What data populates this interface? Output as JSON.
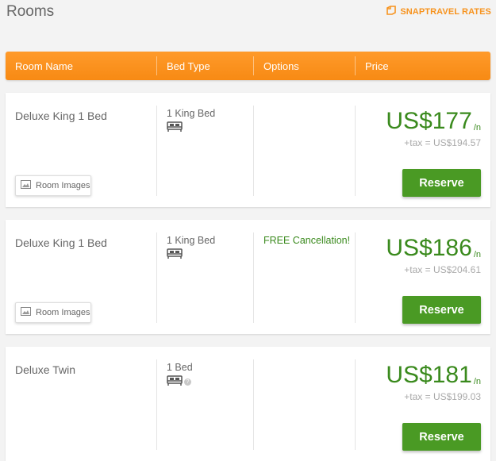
{
  "page": {
    "title": "Rooms",
    "badge_label": "SNAPTRAVEL RATES",
    "accent_color": "#f7931e",
    "price_color": "#3a8a1d",
    "reserve_color": "#4a9a24"
  },
  "table": {
    "headers": {
      "room_name": "Room Name",
      "bed_type": "Bed Type",
      "options": "Options",
      "price": "Price"
    }
  },
  "rooms": [
    {
      "name": "Deluxe King 1 Bed",
      "bed": "1 King Bed",
      "bed_icon": "bed-icon",
      "option": "",
      "price": "US$177",
      "per_night": "/n",
      "tax": "+tax = US$194.57",
      "images_label": "Room Images",
      "reserve_label": "Reserve"
    },
    {
      "name": "Deluxe King 1 Bed",
      "bed": "1 King Bed",
      "bed_icon": "bed-icon",
      "option": "FREE Cancellation!",
      "price": "US$186",
      "per_night": "/n",
      "tax": "+tax = US$204.61",
      "images_label": "Room Images",
      "reserve_label": "Reserve"
    },
    {
      "name": "Deluxe Twin",
      "bed": "1 Bed",
      "bed_icon": "bed-icon",
      "help_icon": "question-icon",
      "option": "",
      "price": "US$181",
      "per_night": "/n",
      "tax": "+tax = US$199.03",
      "reserve_label": "Reserve"
    }
  ]
}
